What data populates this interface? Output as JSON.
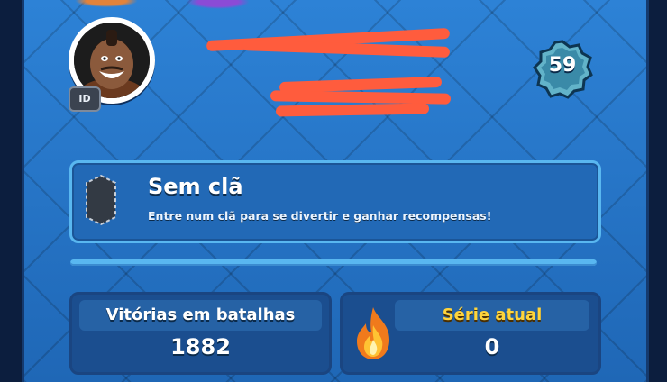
{
  "profile": {
    "avatar_name": "hog-rider-avatar",
    "id_badge": "ID",
    "level": "59",
    "scribble_color": "#ff5c3d"
  },
  "clan": {
    "title": "Sem clã",
    "subtitle": "Entre num clã para se divertir e ganhar recompensas!",
    "icon": "empty-clan-shield-icon"
  },
  "stats": {
    "wins_label": "Vitórias em batalhas",
    "wins_value": "1882",
    "streak_label": "Série atual",
    "streak_value": "0",
    "streak_icon": "flame-icon"
  },
  "colors": {
    "background": "#2473c4",
    "accent": "#59b7f0",
    "streak_label": "#ffd43b"
  }
}
